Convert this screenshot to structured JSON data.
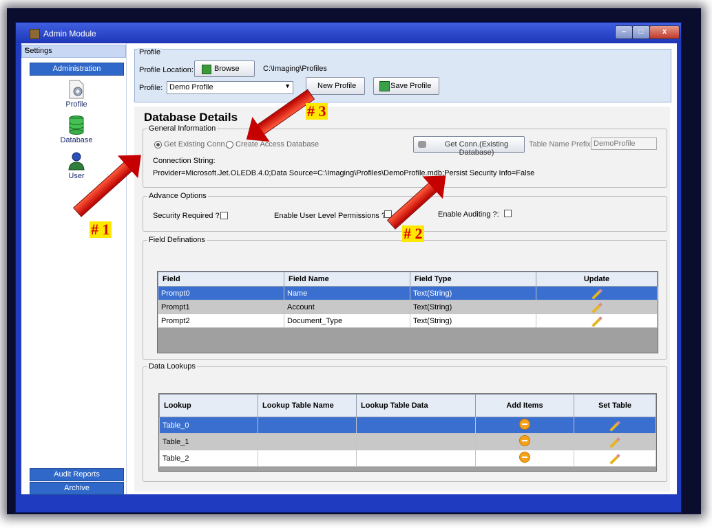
{
  "window": {
    "title": "Admin Module",
    "min": "–",
    "max": "□",
    "close": "x"
  },
  "sidebar": {
    "header": "Settings",
    "pin": "ᵖ",
    "section": "Administration",
    "items": [
      {
        "label": "Profile",
        "icon": "profile-icon"
      },
      {
        "label": "Database",
        "icon": "database-icon"
      },
      {
        "label": "User",
        "icon": "user-icon"
      }
    ],
    "bottom": [
      "Audit Reports",
      "Archive"
    ]
  },
  "profile": {
    "group_title": "Profile",
    "location_label": "Profile Location:",
    "browse_label": "Browse",
    "location_value": "C:\\Imaging\\Profiles",
    "profile_label": "Profile:",
    "profile_value": "Demo Profile",
    "new_label": "New Profile",
    "save_label": "Save Profile"
  },
  "database": {
    "title": "Database Details",
    "general": {
      "legend": "General Information",
      "radio1": "Get Existing Conn.",
      "radio2": "Create Access Database",
      "get_conn_button": "Get Conn.(Existing Database)",
      "prefix_label": "Table Name Prefix:",
      "prefix_value": "DemoProfile",
      "conn_label": "Connection String:",
      "conn_value": "Provider=Microsoft.Jet.OLEDB.4.0;Data Source=C:\\Imaging\\Profiles\\DemoProfile.mdb;Persist Security Info=False"
    },
    "advance": {
      "legend": "Advance Options",
      "security": "Security Required ?:",
      "user_level": "Enable User Level Permissions ?:",
      "auditing": "Enable Auditing ?:"
    },
    "fields": {
      "legend": "Field Definations",
      "columns": [
        "Field",
        "Field Name",
        "Field Type",
        "Update"
      ],
      "rows": [
        [
          "Prompt0",
          "Name",
          "Text(String)"
        ],
        [
          "Prompt1",
          "Account",
          "Text(String)"
        ],
        [
          "Prompt2",
          "Document_Type",
          "Text(String)"
        ]
      ]
    },
    "lookups": {
      "legend": "Data Lookups",
      "columns": [
        "Lookup",
        "Lookup Table Name",
        "Lookup Table Data",
        "Add Items",
        "Set Table"
      ],
      "rows": [
        "Table_0",
        "Table_1",
        "Table_2"
      ]
    }
  },
  "annotations": {
    "a1": "# 1",
    "a2": "# 2",
    "a3": "# 3"
  }
}
